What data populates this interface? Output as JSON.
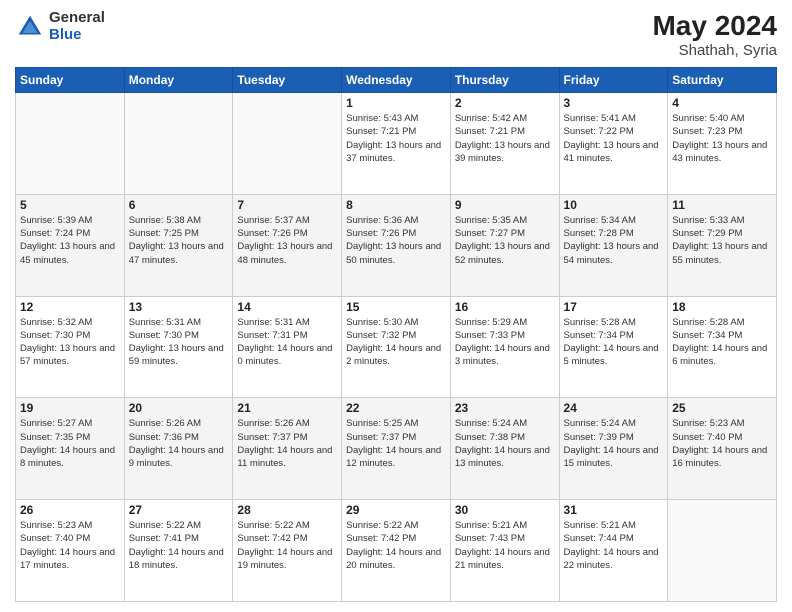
{
  "logo": {
    "general": "General",
    "blue": "Blue"
  },
  "title": {
    "month": "May 2024",
    "location": "Shathah, Syria"
  },
  "weekdays": [
    "Sunday",
    "Monday",
    "Tuesday",
    "Wednesday",
    "Thursday",
    "Friday",
    "Saturday"
  ],
  "weeks": [
    [
      {
        "day": "",
        "info": ""
      },
      {
        "day": "",
        "info": ""
      },
      {
        "day": "",
        "info": ""
      },
      {
        "day": "1",
        "info": "Sunrise: 5:43 AM\nSunset: 7:21 PM\nDaylight: 13 hours\nand 37 minutes."
      },
      {
        "day": "2",
        "info": "Sunrise: 5:42 AM\nSunset: 7:21 PM\nDaylight: 13 hours\nand 39 minutes."
      },
      {
        "day": "3",
        "info": "Sunrise: 5:41 AM\nSunset: 7:22 PM\nDaylight: 13 hours\nand 41 minutes."
      },
      {
        "day": "4",
        "info": "Sunrise: 5:40 AM\nSunset: 7:23 PM\nDaylight: 13 hours\nand 43 minutes."
      }
    ],
    [
      {
        "day": "5",
        "info": "Sunrise: 5:39 AM\nSunset: 7:24 PM\nDaylight: 13 hours\nand 45 minutes."
      },
      {
        "day": "6",
        "info": "Sunrise: 5:38 AM\nSunset: 7:25 PM\nDaylight: 13 hours\nand 47 minutes."
      },
      {
        "day": "7",
        "info": "Sunrise: 5:37 AM\nSunset: 7:26 PM\nDaylight: 13 hours\nand 48 minutes."
      },
      {
        "day": "8",
        "info": "Sunrise: 5:36 AM\nSunset: 7:26 PM\nDaylight: 13 hours\nand 50 minutes."
      },
      {
        "day": "9",
        "info": "Sunrise: 5:35 AM\nSunset: 7:27 PM\nDaylight: 13 hours\nand 52 minutes."
      },
      {
        "day": "10",
        "info": "Sunrise: 5:34 AM\nSunset: 7:28 PM\nDaylight: 13 hours\nand 54 minutes."
      },
      {
        "day": "11",
        "info": "Sunrise: 5:33 AM\nSunset: 7:29 PM\nDaylight: 13 hours\nand 55 minutes."
      }
    ],
    [
      {
        "day": "12",
        "info": "Sunrise: 5:32 AM\nSunset: 7:30 PM\nDaylight: 13 hours\nand 57 minutes."
      },
      {
        "day": "13",
        "info": "Sunrise: 5:31 AM\nSunset: 7:30 PM\nDaylight: 13 hours\nand 59 minutes."
      },
      {
        "day": "14",
        "info": "Sunrise: 5:31 AM\nSunset: 7:31 PM\nDaylight: 14 hours\nand 0 minutes."
      },
      {
        "day": "15",
        "info": "Sunrise: 5:30 AM\nSunset: 7:32 PM\nDaylight: 14 hours\nand 2 minutes."
      },
      {
        "day": "16",
        "info": "Sunrise: 5:29 AM\nSunset: 7:33 PM\nDaylight: 14 hours\nand 3 minutes."
      },
      {
        "day": "17",
        "info": "Sunrise: 5:28 AM\nSunset: 7:34 PM\nDaylight: 14 hours\nand 5 minutes."
      },
      {
        "day": "18",
        "info": "Sunrise: 5:28 AM\nSunset: 7:34 PM\nDaylight: 14 hours\nand 6 minutes."
      }
    ],
    [
      {
        "day": "19",
        "info": "Sunrise: 5:27 AM\nSunset: 7:35 PM\nDaylight: 14 hours\nand 8 minutes."
      },
      {
        "day": "20",
        "info": "Sunrise: 5:26 AM\nSunset: 7:36 PM\nDaylight: 14 hours\nand 9 minutes."
      },
      {
        "day": "21",
        "info": "Sunrise: 5:26 AM\nSunset: 7:37 PM\nDaylight: 14 hours\nand 11 minutes."
      },
      {
        "day": "22",
        "info": "Sunrise: 5:25 AM\nSunset: 7:37 PM\nDaylight: 14 hours\nand 12 minutes."
      },
      {
        "day": "23",
        "info": "Sunrise: 5:24 AM\nSunset: 7:38 PM\nDaylight: 14 hours\nand 13 minutes."
      },
      {
        "day": "24",
        "info": "Sunrise: 5:24 AM\nSunset: 7:39 PM\nDaylight: 14 hours\nand 15 minutes."
      },
      {
        "day": "25",
        "info": "Sunrise: 5:23 AM\nSunset: 7:40 PM\nDaylight: 14 hours\nand 16 minutes."
      }
    ],
    [
      {
        "day": "26",
        "info": "Sunrise: 5:23 AM\nSunset: 7:40 PM\nDaylight: 14 hours\nand 17 minutes."
      },
      {
        "day": "27",
        "info": "Sunrise: 5:22 AM\nSunset: 7:41 PM\nDaylight: 14 hours\nand 18 minutes."
      },
      {
        "day": "28",
        "info": "Sunrise: 5:22 AM\nSunset: 7:42 PM\nDaylight: 14 hours\nand 19 minutes."
      },
      {
        "day": "29",
        "info": "Sunrise: 5:22 AM\nSunset: 7:42 PM\nDaylight: 14 hours\nand 20 minutes."
      },
      {
        "day": "30",
        "info": "Sunrise: 5:21 AM\nSunset: 7:43 PM\nDaylight: 14 hours\nand 21 minutes."
      },
      {
        "day": "31",
        "info": "Sunrise: 5:21 AM\nSunset: 7:44 PM\nDaylight: 14 hours\nand 22 minutes."
      },
      {
        "day": "",
        "info": ""
      }
    ]
  ]
}
